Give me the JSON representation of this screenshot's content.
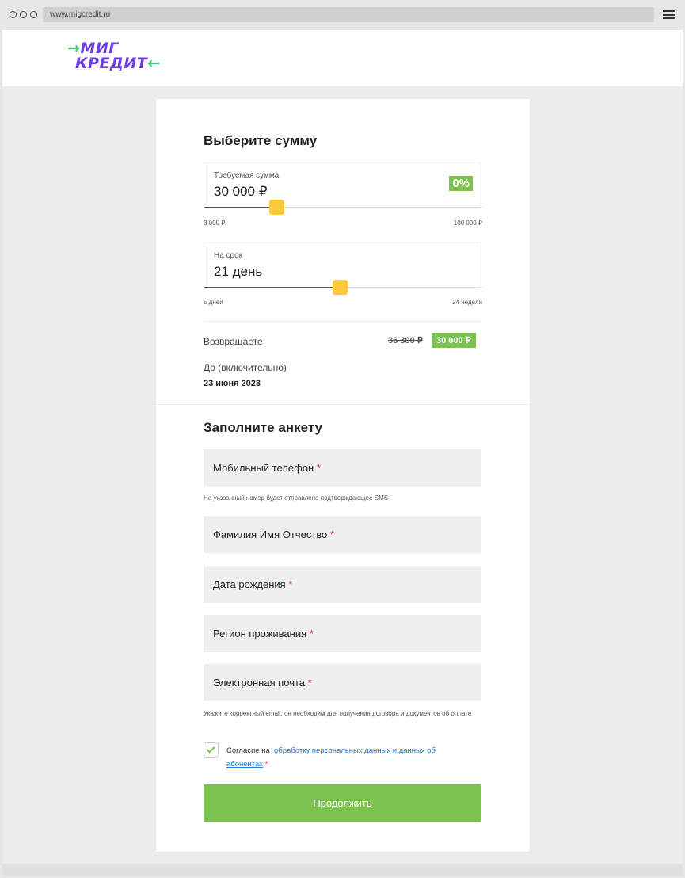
{
  "browser": {
    "url": "www.migcredit.ru"
  },
  "logo": {
    "line1": "МИГ",
    "line2": "КРЕДИТ"
  },
  "amount_section": {
    "title": "Выберите сумму",
    "amount_label": "Требуемая сумма",
    "amount_value": "30 000 ₽",
    "rate_badge": "0%",
    "amount_min": "3 000 ₽",
    "amount_max": "100 000 ₽",
    "amount_slider_fraction": 0.26,
    "term_label": "На срок",
    "term_value": "21 день",
    "term_min": "5 дней",
    "term_max": "24 недели",
    "term_slider_fraction": 0.49,
    "return_label": "Возвращаете",
    "return_old": "36 300 ₽",
    "return_new": "30 000 ₽",
    "due_label": "До (включительно)",
    "due_date": "23 июня 2023"
  },
  "form": {
    "title": "Заполните анкету",
    "phone_label": "Мобильный телефон",
    "phone_hint": "На указанный номер будет отправлено подтверждающее SMS",
    "name_label": "Фамилия Имя Отчество",
    "birth_label": "Дата рождения",
    "region_label": "Регион проживания",
    "email_label": "Электронная почта",
    "email_hint": "Укажите корректный email, он необходим для получения договора и документов об оплате",
    "required_mark": "*",
    "consent_prefix": "Согласие на",
    "consent_link": "обработку персональных данных и данных об абонентах",
    "consent_checked": true,
    "submit_label": "Продолжить"
  },
  "colors": {
    "accent_green": "#7cc24e",
    "thumb_yellow": "#fdc83a",
    "brand_purple": "#6a3de8",
    "required_red": "#e0262b"
  }
}
